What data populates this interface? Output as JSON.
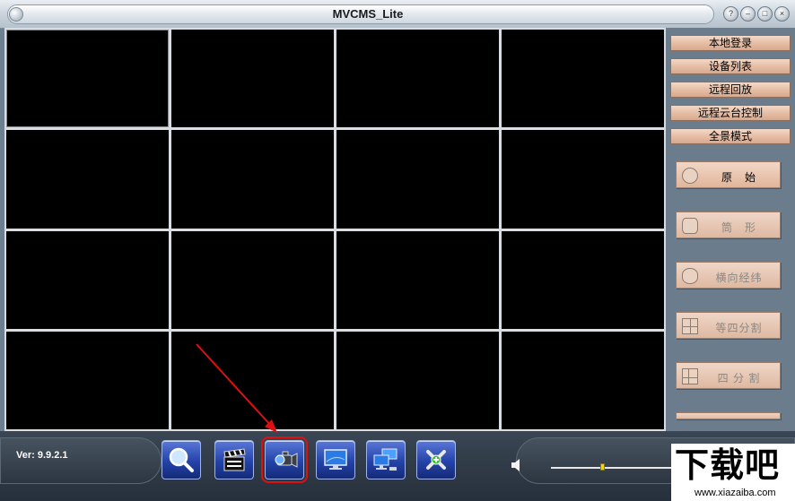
{
  "window": {
    "title": "MVCMS_Lite",
    "controls": [
      "help-icon",
      "minimize-icon",
      "maximize-icon",
      "close-icon"
    ]
  },
  "video_grid": {
    "rows": 4,
    "columns": 4,
    "selected_cell": 0
  },
  "right_panel": {
    "menu": [
      {
        "label": "本地登录"
      },
      {
        "label": "设备列表"
      },
      {
        "label": "远程回放"
      },
      {
        "label": "远程云台控制"
      },
      {
        "label": "全景模式"
      }
    ],
    "modes": [
      {
        "label": "原　始",
        "icon": "circle-icon",
        "enabled": true
      },
      {
        "label": "筒　形",
        "icon": "cylinder-icon",
        "enabled": false
      },
      {
        "label": "横向经纬",
        "icon": "ellipse-icon",
        "enabled": false
      },
      {
        "label": "等四分割",
        "icon": "quad-split-icon",
        "enabled": false
      },
      {
        "label": "四 分 割",
        "icon": "four-split-icon",
        "enabled": false
      }
    ]
  },
  "bottom_bar": {
    "version": "Ver: 9.9.2.1",
    "tools": [
      {
        "icon": "search-icon"
      },
      {
        "icon": "clapperboard-icon"
      },
      {
        "icon": "camera-icon",
        "selected": true
      },
      {
        "icon": "monitor-icon"
      },
      {
        "icon": "network-computers-icon"
      },
      {
        "icon": "settings-tools-icon"
      }
    ],
    "volume": 0.42
  },
  "watermark": {
    "main": "下载吧",
    "url": "www.xiazaiba.com"
  },
  "colors": {
    "selected_cell_border": "#3cc43c",
    "highlight_outline": "#e01010",
    "button_peach": "#e6bea6"
  }
}
